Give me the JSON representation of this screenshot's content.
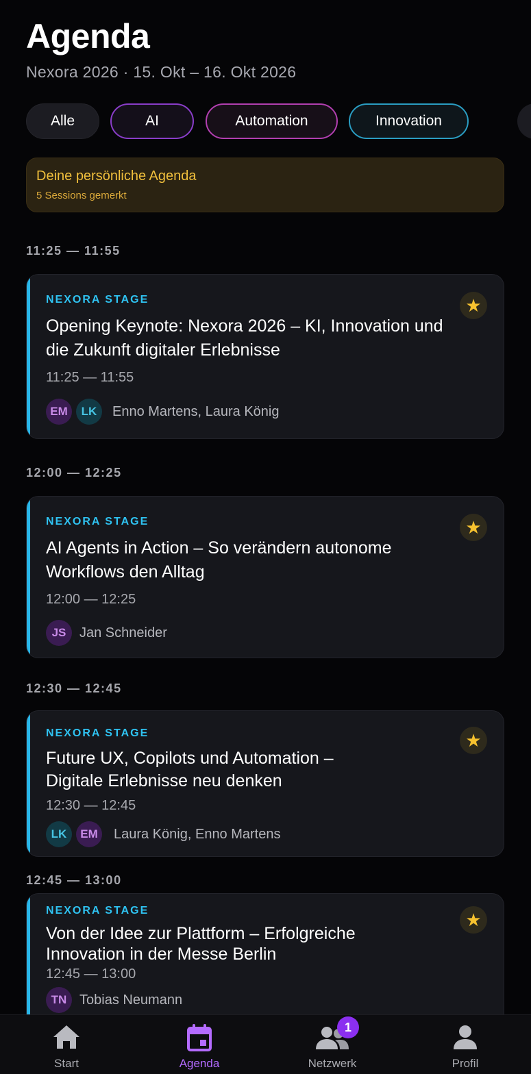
{
  "header": {
    "title": "Agenda",
    "subtitle": "Nexora 2026 · 15. Okt – 16. Okt 2026"
  },
  "filters": [
    {
      "label": "Alle"
    },
    {
      "label": "AI"
    },
    {
      "label": "Automation"
    },
    {
      "label": "Innovation"
    }
  ],
  "notice": {
    "title": "Deine persönliche Agenda",
    "subtitle": "5 Sessions gemerkt"
  },
  "slots": [
    {
      "header": "11:25 — 11:55",
      "stage": "NEXORA STAGE",
      "title": "Opening Keynote: Nexora 2026 – KI, Innovation und die Zukunft digitaler Erlebnisse",
      "time": "11:25 — 11:55",
      "avatars": [
        "EM",
        "LK"
      ],
      "speakers": "Enno Martens, Laura König",
      "starred": true
    },
    {
      "header": "12:00 — 12:25",
      "stage": "NEXORA STAGE",
      "title": "AI Agents in Action – So verändern autonome Workflows den Alltag",
      "time": "12:00 — 12:25",
      "avatars": [
        "JS"
      ],
      "speakers": "Jan Schneider",
      "starred": true
    },
    {
      "header": "12:30 — 12:45",
      "stage": "NEXORA STAGE",
      "title": "Future UX, Copilots und Automation – Digitale Erlebnisse neu denken",
      "time": "12:30 — 12:45",
      "avatars": [
        "LK",
        "EM"
      ],
      "speakers": "Laura König, Enno Martens",
      "starred": true
    },
    {
      "header": "12:45 — 13:00",
      "stage": "NEXORA STAGE",
      "title": "Von der Idee zur Plattform – Erfolgreiche Innovation in der Messe Berlin",
      "time": "12:45 — 13:00",
      "avatars": [
        "TN"
      ],
      "speakers": "Tobias Neumann",
      "starred": true
    }
  ],
  "star_icon": "★",
  "nav": [
    {
      "label": "Start",
      "icon": "home-icon"
    },
    {
      "label": "Agenda",
      "icon": "calendar-icon",
      "active": true
    },
    {
      "label": "Netzwerk",
      "icon": "people-icon",
      "badge": "1"
    },
    {
      "label": "Profil",
      "icon": "person-icon"
    }
  ],
  "colors": {
    "background": "#050507",
    "stage_accent": "#29b6e8",
    "star": "#f6c12f",
    "active_nav": "#b46bff",
    "notice_text": "#f0bf3c"
  }
}
